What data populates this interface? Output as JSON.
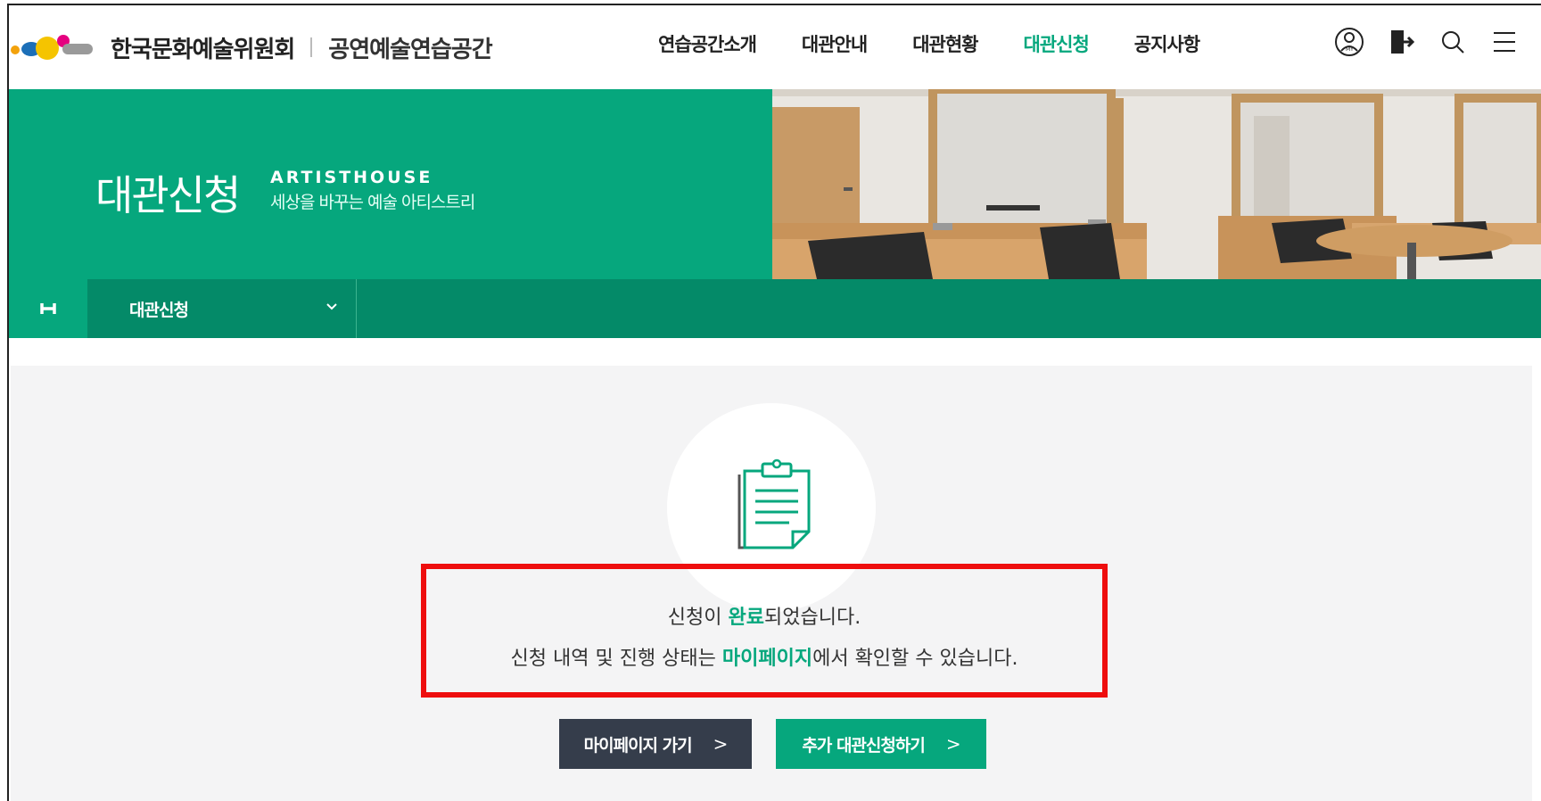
{
  "header": {
    "org_name": "한국문화예술위원회",
    "site_name": "공연예술연습공간",
    "nav": [
      {
        "label": "연습공간소개",
        "active": false
      },
      {
        "label": "대관안내",
        "active": false
      },
      {
        "label": "대관현황",
        "active": false
      },
      {
        "label": "대관신청",
        "active": true
      },
      {
        "label": "공지사항",
        "active": false
      }
    ],
    "utility_icons": [
      "mypage-icon",
      "logout-icon",
      "search-icon",
      "menu-icon"
    ]
  },
  "visual": {
    "title": "대관신청",
    "subtitle_en": "ARTISTHOUSE",
    "subtitle_ko": "세상을 바꾸는 예술 아티스트리"
  },
  "location": {
    "home_icon": "home-icon",
    "current": "대관신청"
  },
  "result": {
    "icon": "clipboard-icon",
    "line1_prefix": "신청이 ",
    "line1_highlight": "완료",
    "line1_suffix": "되었습니다.",
    "line2_prefix": "신청 내역 및 진행 상태는 ",
    "line2_highlight": "마이페이지",
    "line2_suffix": "에서 확인할 수 있습니다."
  },
  "buttons": {
    "mypage_label": "마이페이지 가기",
    "more_label": "추가 대관신청하기",
    "arrow": ">"
  },
  "colors": {
    "brand_green": "#06a77d",
    "dark_green": "#048a68",
    "dark_button": "#353d4b",
    "highlight_box": "#ee0e0e"
  }
}
